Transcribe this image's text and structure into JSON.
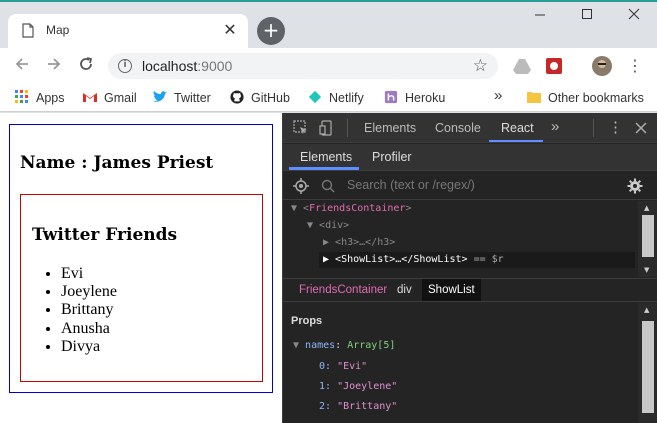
{
  "browser": {
    "tab_title": "Map",
    "address": {
      "host": "localhost",
      "port": ":9000"
    },
    "new_tab_symbol": "+",
    "close_tab_symbol": "✕"
  },
  "bookmarks": {
    "apps": "Apps",
    "items": [
      "Gmail",
      "Twitter",
      "GitHub",
      "Netlify",
      "Heroku"
    ],
    "overflow": "»",
    "other": "Other bookmarks"
  },
  "page": {
    "name_heading": "Name : James Priest",
    "friends_heading": "Twitter Friends",
    "friends": [
      "Evi",
      "Joeylene",
      "Brittany",
      "Anusha",
      "Divya"
    ]
  },
  "devtools": {
    "tabs": [
      "Elements",
      "Console",
      "React"
    ],
    "active_tab": "React",
    "more": "»",
    "sub_tabs": [
      "Elements",
      "Profiler"
    ],
    "search_placeholder": "Search (text or /regex/)",
    "tree": {
      "row1": "FriendsContainer",
      "row2": "div",
      "row3": "h3",
      "row4_tag": "ShowList",
      "row4_suffix": "== $r"
    },
    "breadcrumb": [
      "FriendsContainer",
      "div",
      "ShowList"
    ],
    "props_heading": "Props",
    "props": {
      "key": "names",
      "type": "Array[5]",
      "items": [
        {
          "index": "0:",
          "value": "\"Evi\""
        },
        {
          "index": "1:",
          "value": "\"Joeylene\""
        },
        {
          "index": "2:",
          "value": "\"Brittany\""
        }
      ]
    }
  },
  "colors": {
    "container_border": "#0000cc",
    "showlist_border": "#cc0000",
    "devtools_bg": "#242424",
    "accent": "#5c8fff",
    "tag_color": "#e26bb4"
  }
}
